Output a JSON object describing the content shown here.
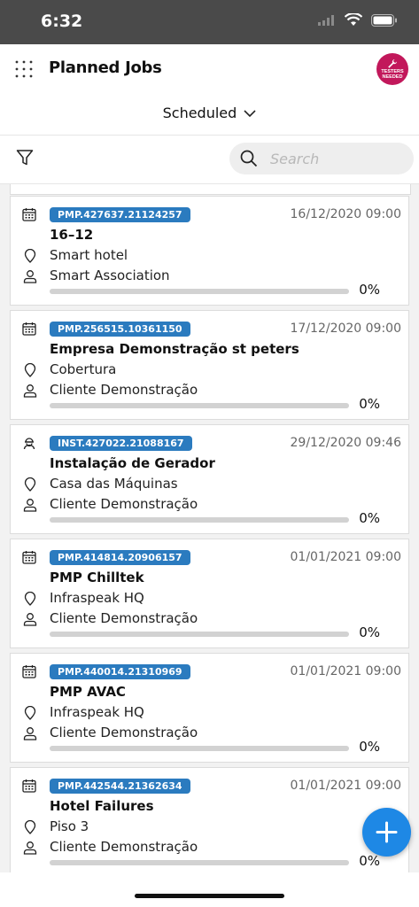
{
  "status_bar": {
    "time": "6:32"
  },
  "header": {
    "title": "Planned Jobs",
    "tester_badge_line1": "TESTERS",
    "tester_badge_line2": "NEEDED"
  },
  "filter": {
    "selected": "Scheduled"
  },
  "search": {
    "placeholder": "Search"
  },
  "colors": {
    "accent": "#2b7bbf",
    "fab": "#1e88e5",
    "badge": "#c2185b"
  },
  "jobs": [
    {
      "code": "PMP.427637.21124257",
      "date": "16/12/2020 09:00",
      "title": "16–12",
      "location": "Smart hotel",
      "client": "Smart Association",
      "progress": "0%",
      "progress_value": 0,
      "icon": "calendar-icon"
    },
    {
      "code": "PMP.256515.10361150",
      "date": "17/12/2020 09:00",
      "title": "Empresa Demonstração st peters",
      "location": "Cobertura",
      "client": "Cliente Demonstração",
      "progress": "0%",
      "progress_value": 0,
      "icon": "calendar-icon"
    },
    {
      "code": "INST.427022.21088167",
      "date": "29/12/2020 09:46",
      "title": "Instalação de Gerador",
      "location": "Casa das Máquinas",
      "client": "Cliente Demonstração",
      "progress": "0%",
      "progress_value": 0,
      "icon": "technician-icon"
    },
    {
      "code": "PMP.414814.20906157",
      "date": "01/01/2021 09:00",
      "title": "PMP Chilltek",
      "location": "Infraspeak HQ",
      "client": "Cliente Demonstração",
      "progress": "0%",
      "progress_value": 0,
      "icon": "calendar-icon"
    },
    {
      "code": "PMP.440014.21310969",
      "date": "01/01/2021 09:00",
      "title": "PMP AVAC",
      "location": "Infraspeak HQ",
      "client": "Cliente Demonstração",
      "progress": "0%",
      "progress_value": 0,
      "icon": "calendar-icon"
    },
    {
      "code": "PMP.442544.21362634",
      "date": "01/01/2021 09:00",
      "title": "Hotel Failures",
      "location": "Piso 3",
      "client": "Cliente Demonstração",
      "progress": "0%",
      "progress_value": 0,
      "icon": "calendar-icon"
    }
  ]
}
